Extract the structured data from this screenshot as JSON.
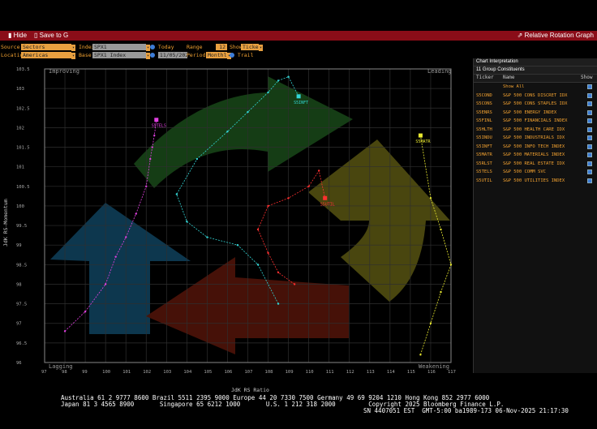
{
  "toolbar": {
    "hide_label": "Hide",
    "save_label": "Save to G",
    "title": "Relative Rotation Graph"
  },
  "controls": {
    "source_label": "Source",
    "source_value": "Sectors",
    "location_label": "Location",
    "location_value": "Americas",
    "index_label": "Index",
    "index_value": "SPX1",
    "base_label": "Base",
    "base_value": "SPX1 Index",
    "today_label": "Today",
    "date_value": "11/05/2025",
    "range_label": "Range",
    "range_value": "12",
    "period_label": "Period",
    "period_value": "Monthly",
    "show_label": "Show",
    "show_value": "Ticker",
    "trail_label": "Trail"
  },
  "panel": {
    "chart_interp": "Chart Interpretation",
    "constituents": "11 Group Constituents",
    "col_ticker": "Ticker",
    "col_name": "Name",
    "col_show": "Show",
    "show_all": "Show All",
    "rows": [
      {
        "ticker": "S5COND",
        "name": "S&P 500 CONS DISCRET IDX"
      },
      {
        "ticker": "S5CONS",
        "name": "S&P 500 CONS STAPLES IDX"
      },
      {
        "ticker": "S5ENRS",
        "name": "S&P 500 ENERGY INDEX"
      },
      {
        "ticker": "S5FINL",
        "name": "S&P 500 FINANCIALS INDEX"
      },
      {
        "ticker": "S5HLTH",
        "name": "S&P 500 HEALTH CARE IDX"
      },
      {
        "ticker": "S5INDU",
        "name": "S&P 500 INDUSTRIALS IDX"
      },
      {
        "ticker": "S5INFT",
        "name": "S&P 500 INFO TECH INDEX"
      },
      {
        "ticker": "S5MATR",
        "name": "S&P 500 MATERIALS INDEX"
      },
      {
        "ticker": "S5RLST",
        "name": "S&P 500 REAL ESTATE IDX"
      },
      {
        "ticker": "S5TELS",
        "name": "S&P 500 COMM SVC"
      },
      {
        "ticker": "S5UTIL",
        "name": "S&P 500 UTILITIES INDEX"
      }
    ]
  },
  "quadrants": {
    "improving": "Improving",
    "leading": "Leading",
    "lagging": "Lagging",
    "weakening": "Weakening"
  },
  "axes": {
    "xlabel": "JdK RS Ratio",
    "ylabel": "JdK RS-Momentum",
    "xticks": [
      "97",
      "98",
      "99",
      "100",
      "101",
      "102",
      "103",
      "104",
      "105",
      "106",
      "107",
      "108",
      "109",
      "110",
      "111",
      "112",
      "113",
      "114",
      "115",
      "116",
      "117"
    ],
    "yticks": [
      "103.5",
      "103",
      "102.5",
      "102",
      "101.5",
      "101",
      "100.5",
      "100",
      "99.5",
      "99",
      "98.5",
      "98",
      "97.5",
      "97",
      "96.5",
      "96"
    ]
  },
  "chart_data": {
    "type": "scatter",
    "series": [
      {
        "name": "S5INFT",
        "color": "#33d6d6",
        "x": [
          108.5,
          107.5,
          106.5,
          105,
          104,
          103.5,
          104.5,
          106,
          107,
          108,
          108.5,
          109,
          109.5
        ],
        "y": [
          97.5,
          98.5,
          99,
          99.2,
          99.6,
          100.3,
          101.2,
          101.9,
          102.4,
          102.9,
          103.2,
          103.3,
          102.8
        ],
        "label_x": 109.3,
        "label_y": 101.0
      },
      {
        "name": "S5TELS",
        "color": "#e040e0",
        "x": [
          98,
          99,
          100,
          100.5,
          101,
          101.5,
          102,
          102.2,
          102.3,
          102.4,
          102.5
        ],
        "y": [
          96.8,
          97.3,
          98,
          98.7,
          99.2,
          99.8,
          100.5,
          101.2,
          101.5,
          101.8,
          102.2
        ],
        "label_x": 101.8,
        "label_y": 99.4
      },
      {
        "name": "S5UTIL",
        "color": "#ff3030",
        "x": [
          109.3,
          108.5,
          108,
          107.5,
          108,
          109,
          110,
          110.5,
          110.8
        ],
        "y": [
          98.0,
          98.3,
          98.8,
          99.4,
          100.0,
          100.2,
          100.5,
          100.9,
          100.2
        ],
        "label_x": 109.3,
        "label_y": 98.0
      },
      {
        "name": "S5MATR",
        "color": "#e8e830",
        "x": [
          115.5,
          116,
          116.5,
          117,
          116.5,
          116,
          115.5
        ],
        "y": [
          96.2,
          97,
          97.8,
          98.5,
          99.4,
          100.2,
          101.8
        ],
        "label_x": 115.2,
        "label_y": 99.1
      }
    ]
  },
  "footer": {
    "line1": "Australia 61 2 9777 8600 Brazil 5511 2395 9000 Europe 44 20 7330 7500 Germany 49 69 9204 1210 Hong Kong 852 2977 6000",
    "line2": "Japan 81 3 4565 8900       Singapore 65 6212 1000       U.S. 1 212 318 2000         Copyright 2025 Bloomberg Finance L.P.",
    "line3": "SN 4407051 EST  GMT-5:00 ba1989-173 06-Nov-2025 21:17:30"
  }
}
